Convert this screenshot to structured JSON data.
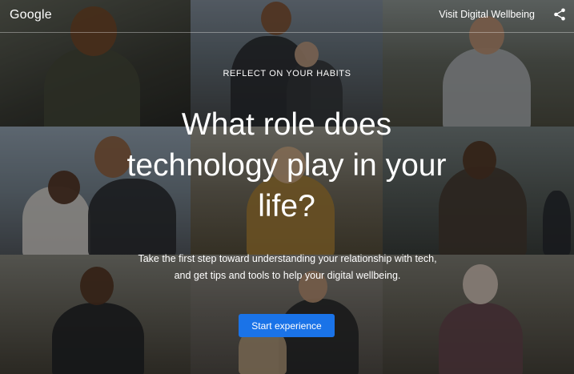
{
  "header": {
    "logo": "Google",
    "visit_link": "Visit Digital Wellbeing",
    "share_icon": "share-icon"
  },
  "hero": {
    "eyebrow": "REFLECT ON YOUR HABITS",
    "headline": "What role does technology play in your life?",
    "subtext": "Take the first step toward understanding your relationship with tech, and get tips and tools to help your digital wellbeing.",
    "cta_label": "Start experience"
  },
  "colors": {
    "accent": "#1a73e8",
    "text": "#ffffff"
  }
}
